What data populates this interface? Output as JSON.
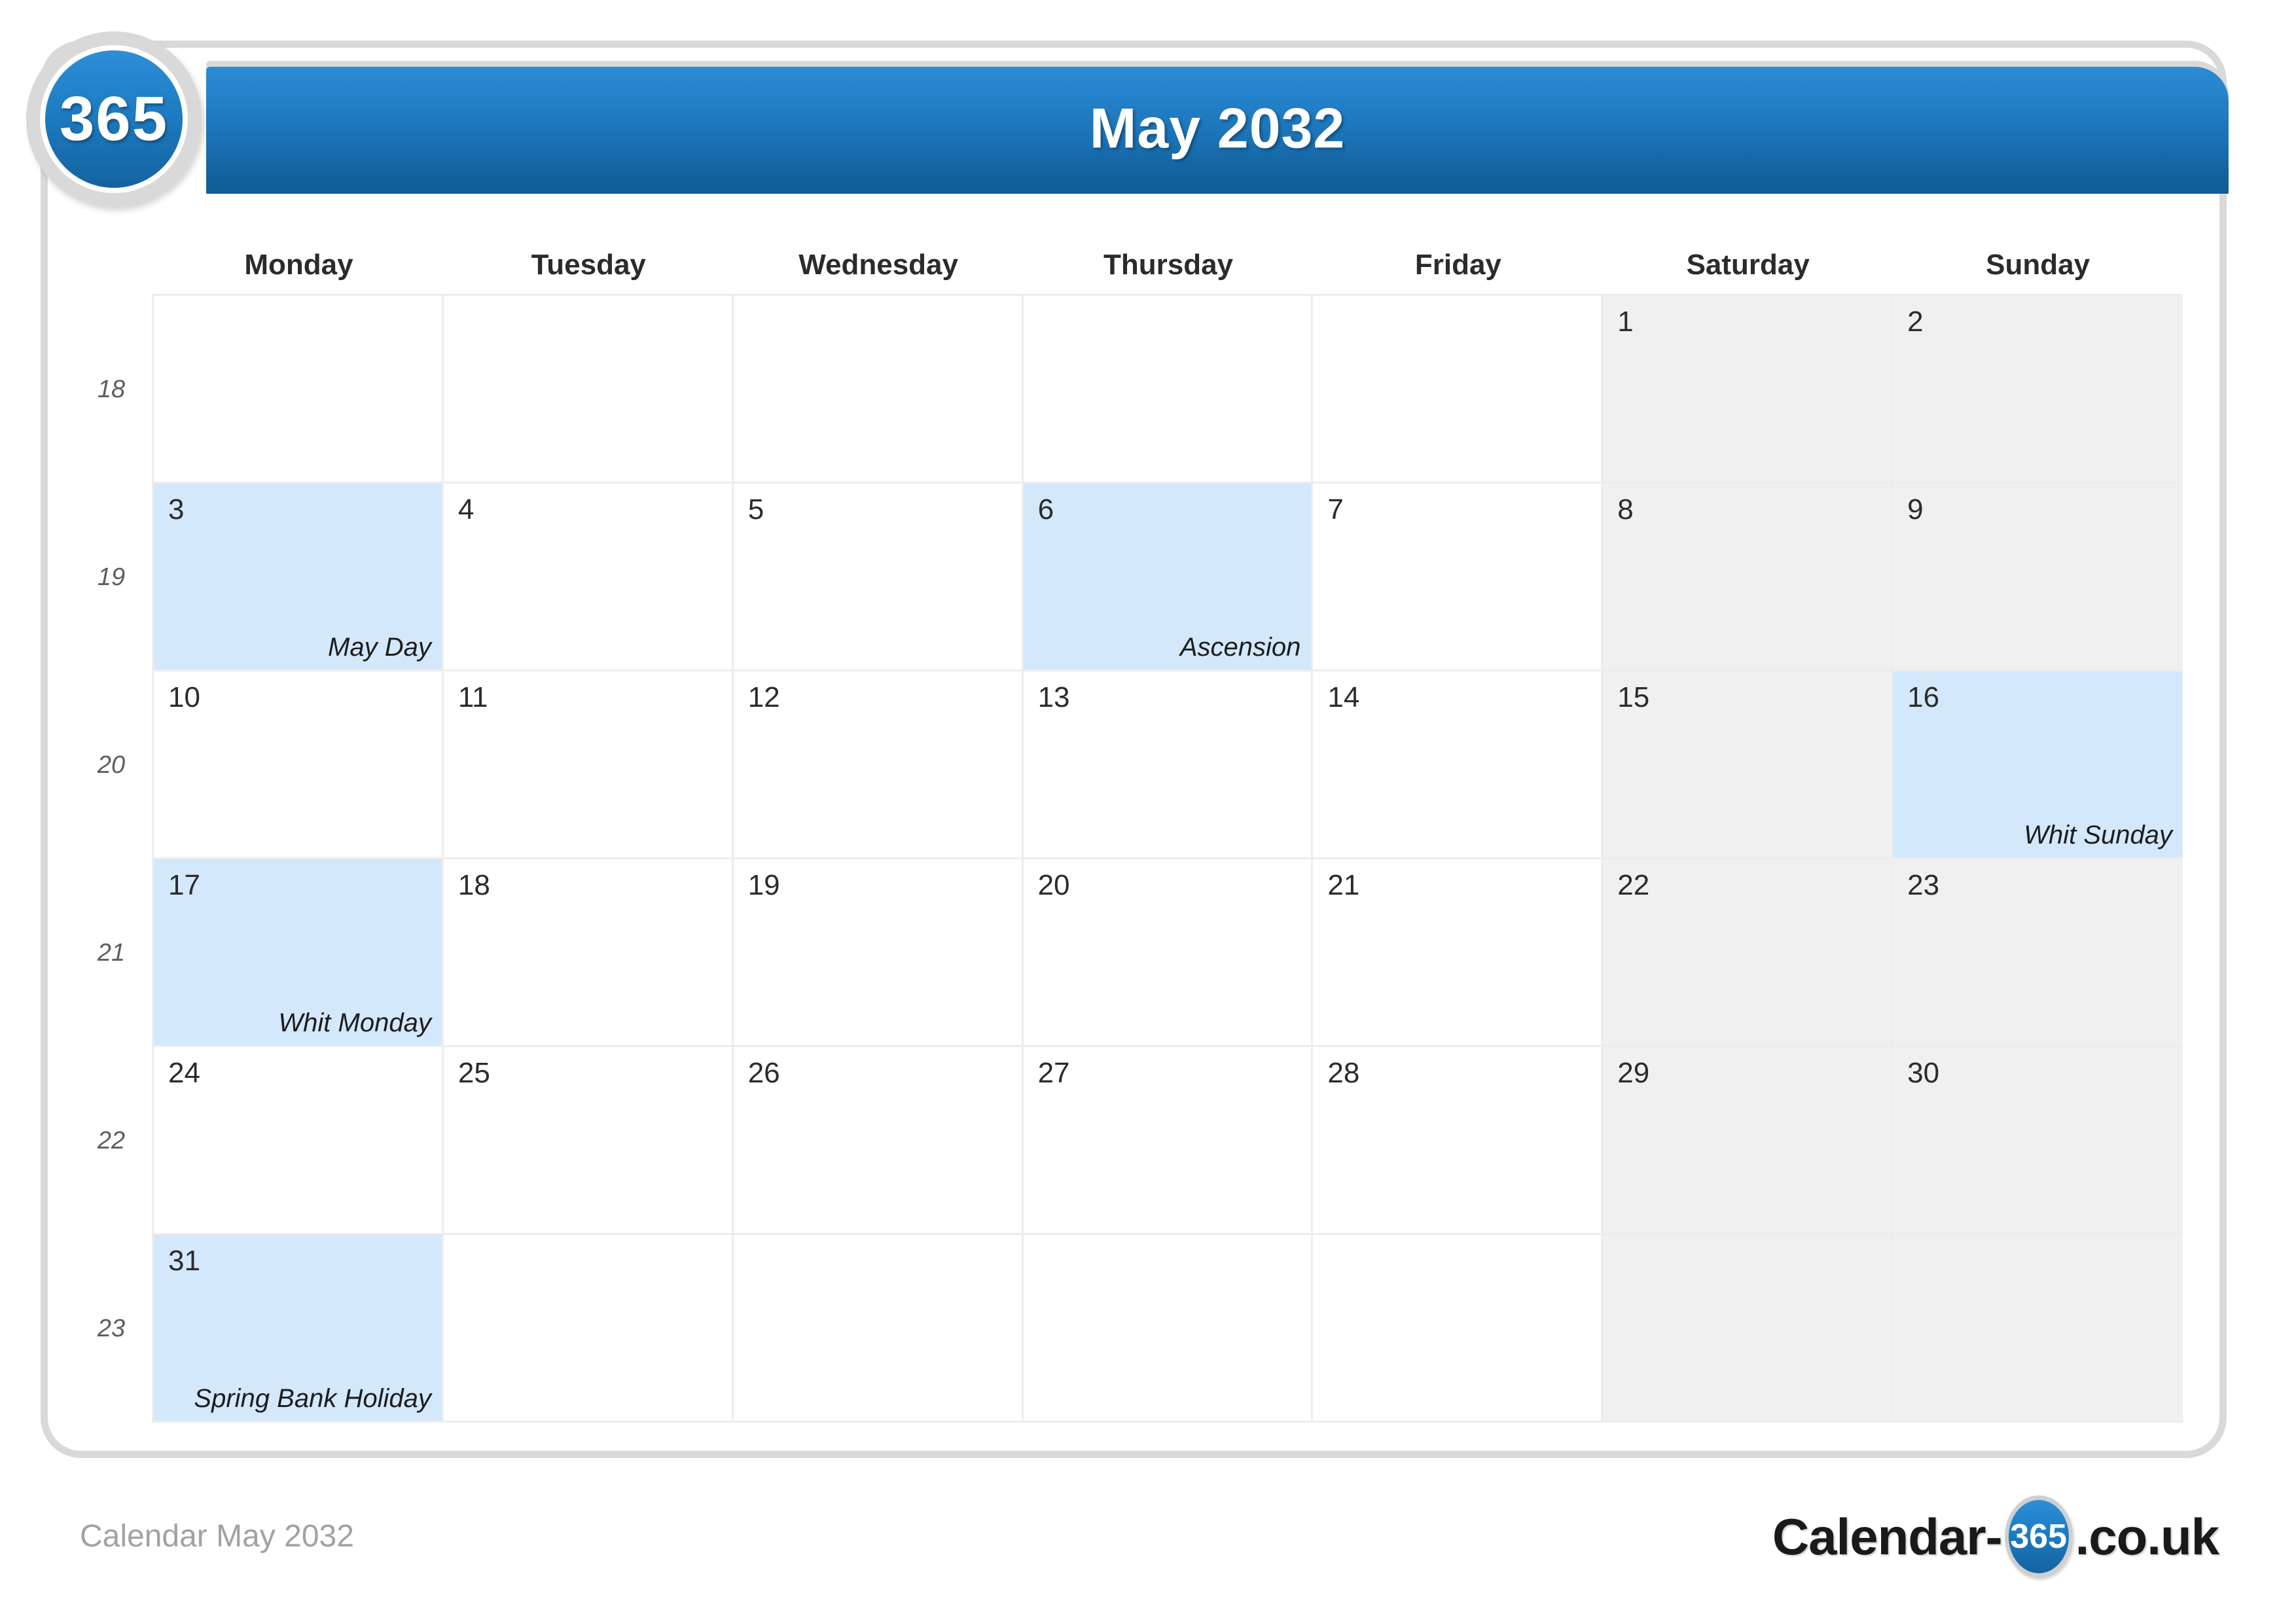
{
  "header": {
    "title": "May 2032",
    "logo_badge_text": "365",
    "logo_badge_icon": "calendar-365-circle-icon"
  },
  "watermark": {
    "text": "365"
  },
  "weekdays": [
    "Monday",
    "Tuesday",
    "Wednesday",
    "Thursday",
    "Friday",
    "Saturday",
    "Sunday"
  ],
  "week_numbers": [
    "18",
    "19",
    "20",
    "21",
    "22",
    "23"
  ],
  "colors": {
    "header_gradient_top": "#2d8ad4",
    "header_gradient_bottom": "#0f5d96",
    "holiday_cell": "#d4e8fb",
    "weekend_cell": "#f0f0f0",
    "grid_line": "#eceded",
    "frame_border": "#d9d9d9",
    "footer_text": "#a2a2a2"
  },
  "weeks": [
    {
      "week": "18",
      "days": [
        {
          "num": "",
          "holiday": "",
          "weekend": false,
          "blank": true
        },
        {
          "num": "",
          "holiday": "",
          "weekend": false,
          "blank": true
        },
        {
          "num": "",
          "holiday": "",
          "weekend": false,
          "blank": true
        },
        {
          "num": "",
          "holiday": "",
          "weekend": false,
          "blank": true
        },
        {
          "num": "",
          "holiday": "",
          "weekend": false,
          "blank": true
        },
        {
          "num": "1",
          "holiday": "",
          "weekend": true,
          "blank": false
        },
        {
          "num": "2",
          "holiday": "",
          "weekend": true,
          "blank": false
        }
      ]
    },
    {
      "week": "19",
      "days": [
        {
          "num": "3",
          "holiday": "May Day",
          "weekend": false,
          "blank": false
        },
        {
          "num": "4",
          "holiday": "",
          "weekend": false,
          "blank": false
        },
        {
          "num": "5",
          "holiday": "",
          "weekend": false,
          "blank": false
        },
        {
          "num": "6",
          "holiday": "Ascension",
          "weekend": false,
          "blank": false
        },
        {
          "num": "7",
          "holiday": "",
          "weekend": false,
          "blank": false
        },
        {
          "num": "8",
          "holiday": "",
          "weekend": true,
          "blank": false
        },
        {
          "num": "9",
          "holiday": "",
          "weekend": true,
          "blank": false
        }
      ]
    },
    {
      "week": "20",
      "days": [
        {
          "num": "10",
          "holiday": "",
          "weekend": false,
          "blank": false
        },
        {
          "num": "11",
          "holiday": "",
          "weekend": false,
          "blank": false
        },
        {
          "num": "12",
          "holiday": "",
          "weekend": false,
          "blank": false
        },
        {
          "num": "13",
          "holiday": "",
          "weekend": false,
          "blank": false
        },
        {
          "num": "14",
          "holiday": "",
          "weekend": false,
          "blank": false
        },
        {
          "num": "15",
          "holiday": "",
          "weekend": true,
          "blank": false
        },
        {
          "num": "16",
          "holiday": "Whit Sunday",
          "weekend": true,
          "blank": false
        }
      ]
    },
    {
      "week": "21",
      "days": [
        {
          "num": "17",
          "holiday": "Whit Monday",
          "weekend": false,
          "blank": false
        },
        {
          "num": "18",
          "holiday": "",
          "weekend": false,
          "blank": false
        },
        {
          "num": "19",
          "holiday": "",
          "weekend": false,
          "blank": false
        },
        {
          "num": "20",
          "holiday": "",
          "weekend": false,
          "blank": false
        },
        {
          "num": "21",
          "holiday": "",
          "weekend": false,
          "blank": false
        },
        {
          "num": "22",
          "holiday": "",
          "weekend": true,
          "blank": false
        },
        {
          "num": "23",
          "holiday": "",
          "weekend": true,
          "blank": false
        }
      ]
    },
    {
      "week": "22",
      "days": [
        {
          "num": "24",
          "holiday": "",
          "weekend": false,
          "blank": false
        },
        {
          "num": "25",
          "holiday": "",
          "weekend": false,
          "blank": false
        },
        {
          "num": "26",
          "holiday": "",
          "weekend": false,
          "blank": false
        },
        {
          "num": "27",
          "holiday": "",
          "weekend": false,
          "blank": false
        },
        {
          "num": "28",
          "holiday": "",
          "weekend": false,
          "blank": false
        },
        {
          "num": "29",
          "holiday": "",
          "weekend": true,
          "blank": false
        },
        {
          "num": "30",
          "holiday": "",
          "weekend": true,
          "blank": false
        }
      ]
    },
    {
      "week": "23",
      "days": [
        {
          "num": "31",
          "holiday": "Spring Bank Holiday",
          "weekend": false,
          "blank": false
        },
        {
          "num": "",
          "holiday": "",
          "weekend": false,
          "blank": true
        },
        {
          "num": "",
          "holiday": "",
          "weekend": false,
          "blank": true
        },
        {
          "num": "",
          "holiday": "",
          "weekend": false,
          "blank": true
        },
        {
          "num": "",
          "holiday": "",
          "weekend": false,
          "blank": true
        },
        {
          "num": "",
          "holiday": "",
          "weekend": true,
          "blank": true
        },
        {
          "num": "",
          "holiday": "",
          "weekend": true,
          "blank": true
        }
      ]
    }
  ],
  "footer": {
    "caption": "Calendar May 2032",
    "brand_prefix": "Calendar-",
    "brand_badge": "365",
    "brand_suffix": ".co.uk"
  }
}
